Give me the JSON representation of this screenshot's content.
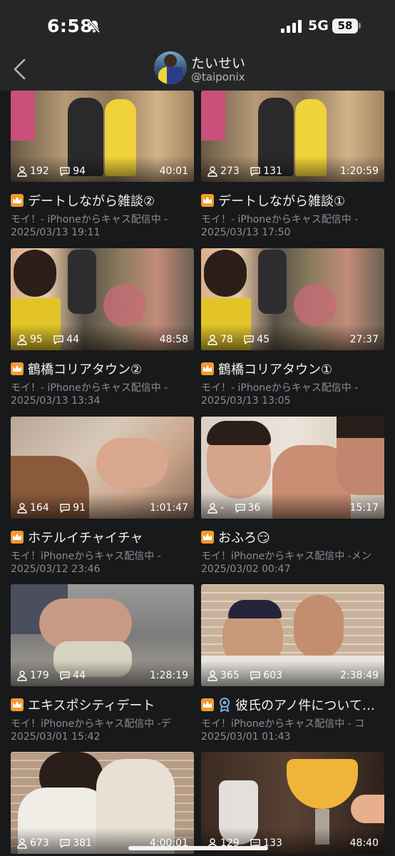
{
  "status": {
    "time": "6:58",
    "network": "5G",
    "battery": "58"
  },
  "header": {
    "name": "たいせい",
    "handle": "@taiponix"
  },
  "cards": [
    {
      "viewers": "192",
      "comments": "94",
      "duration": "40:01",
      "title": "デートしながら雑談②",
      "source": "モイ！- iPhoneからキャス配信中 -",
      "date": "2025/03/13 19:11"
    },
    {
      "viewers": "273",
      "comments": "131",
      "duration": "1:20:59",
      "title": "デートしながら雑談①",
      "source": "モイ！- iPhoneからキャス配信中 -",
      "date": "2025/03/13 17:50"
    },
    {
      "viewers": "95",
      "comments": "44",
      "duration": "48:58",
      "title": "鶴橋コリアタウン②",
      "source": "モイ！- iPhoneからキャス配信中 -",
      "date": "2025/03/13 13:34"
    },
    {
      "viewers": "78",
      "comments": "45",
      "duration": "27:37",
      "title": "鶴橋コリアタウン①",
      "source": "モイ！- iPhoneからキャス配信中 -",
      "date": "2025/03/13 13:05"
    },
    {
      "viewers": "164",
      "comments": "91",
      "duration": "1:01:47",
      "title": "ホテルイチャイチャ",
      "source": "モイ！iPhoneからキャス配信中 -",
      "date": "2025/03/12 23:46"
    },
    {
      "viewers": "-",
      "comments": "36",
      "duration": "15:17",
      "title": "おふろ😏",
      "source": "モイ！iPhoneからキャス配信中 -メン",
      "date": "2025/03/02 00:47"
    },
    {
      "viewers": "179",
      "comments": "44",
      "duration": "1:28:19",
      "title": "エキスポシティデート",
      "source": "モイ！iPhoneからキャス配信中 -デ",
      "date": "2025/03/01 15:42"
    },
    {
      "viewers": "365",
      "comments": "603",
      "duration": "2:38:49",
      "title": "彼氏のアノ件について…",
      "source": "モイ！iPhoneからキャス配信中 - コ",
      "date": "2025/03/01 01:43"
    },
    {
      "viewers": "673",
      "comments": "381",
      "duration": "4:00:01"
    },
    {
      "viewers": "129",
      "comments": "133",
      "duration": "48:40"
    }
  ]
}
